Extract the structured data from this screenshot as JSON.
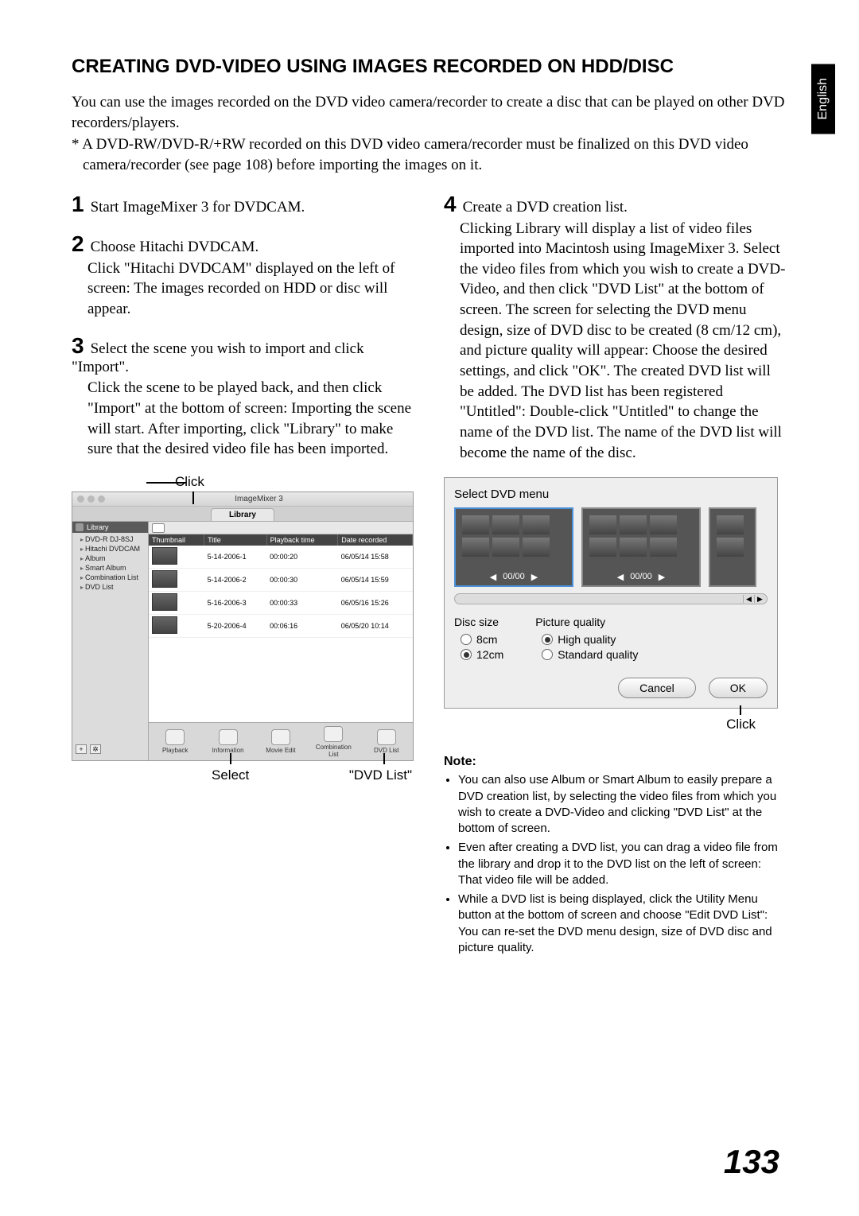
{
  "language_tab": "English",
  "title": "CREATING DVD-VIDEO USING IMAGES RECORDED ON HDD/DISC",
  "intro": {
    "p1": "You can use the images recorded on the DVD video camera/recorder to create a disc that can be played on other DVD recorders/players.",
    "asterisk": "*  A DVD-RW/DVD-R/+RW recorded on this DVD video camera/recorder must be finalized on this DVD video camera/recorder (see page 108) before importing the images on it."
  },
  "steps": {
    "s1": {
      "num": "1",
      "lead": "Start ImageMixer 3 for DVDCAM."
    },
    "s2": {
      "num": "2",
      "lead": "Choose Hitachi DVDCAM.",
      "body": "Click \"Hitachi DVDCAM\" displayed on the left of screen: The images recorded on HDD or disc will appear."
    },
    "s3": {
      "num": "3",
      "lead": "Select the scene you wish to import and click \"Import\".",
      "body": "Click the scene to be played back, and then click \"Import\" at the bottom of screen: Importing the scene will start.\nAfter importing, click \"Library\" to make sure that the desired video file has been imported."
    },
    "s4": {
      "num": "4",
      "lead": "Create a DVD creation list.",
      "body": "Clicking Library will display a list of video files imported into Macintosh using ImageMixer 3.\nSelect the video files from which you wish to create a DVD-Video, and then click \"DVD List\" at the bottom of screen. The screen for selecting the DVD menu design, size of DVD disc to be created (8 cm/12 cm), and picture quality will appear: Choose the desired settings, and click \"OK\".\nThe created DVD list will be added.\nThe DVD list has been registered \"Untitled\": Double-click \"Untitled\" to change the name of the DVD list. The name of the DVD list will become the name of the disc."
    }
  },
  "callouts": {
    "click": "Click",
    "select": "Select",
    "dvdlist": "\"DVD List\""
  },
  "shot1": {
    "window_title": "ImageMixer 3",
    "tab": "Library",
    "sidebar_header": "Library",
    "sidebar_items": [
      "DVD-R DJ-8SJ",
      "Hitachi DVDCAM",
      "Album",
      "Smart Album",
      "Combination List",
      "DVD List"
    ],
    "columns": [
      "Thumbnail",
      "Title",
      "Playback time",
      "Date recorded"
    ],
    "rows": [
      {
        "title": "5-14-2006-1",
        "time": "00:00:20",
        "date": "06/05/14 15:58"
      },
      {
        "title": "5-14-2006-2",
        "time": "00:00:30",
        "date": "06/05/14 15:59"
      },
      {
        "title": "5-16-2006-3",
        "time": "00:00:33",
        "date": "06/05/16 15:26"
      },
      {
        "title": "5-20-2006-4",
        "time": "00:06:16",
        "date": "06/05/20 10:14"
      }
    ],
    "toolbar": [
      "Playback",
      "Information",
      "Movie Edit",
      "Combination List",
      "DVD List"
    ]
  },
  "shot2": {
    "header": "Select DVD menu",
    "disc_size_label": "Disc size",
    "disc_8": "8cm",
    "disc_12": "12cm",
    "pq_label": "Picture quality",
    "pq_high": "High quality",
    "pq_std": "Standard quality",
    "cancel": "Cancel",
    "ok": "OK"
  },
  "note": {
    "heading": "Note:",
    "items": [
      "You can also use Album or Smart Album to easily prepare a DVD creation list, by selecting the video files from which you wish to create a DVD-Video and clicking \"DVD List\" at the bottom of screen.",
      "Even after creating a DVD list, you can drag a video file from the library and drop it to the DVD list on the left of screen: That video file will be added.",
      "While a DVD list is being displayed, click the Utility Menu button at the bottom of screen and choose \"Edit DVD List\": You can re-set the DVD menu design, size of DVD disc and picture quality."
    ]
  },
  "page_number": "133"
}
